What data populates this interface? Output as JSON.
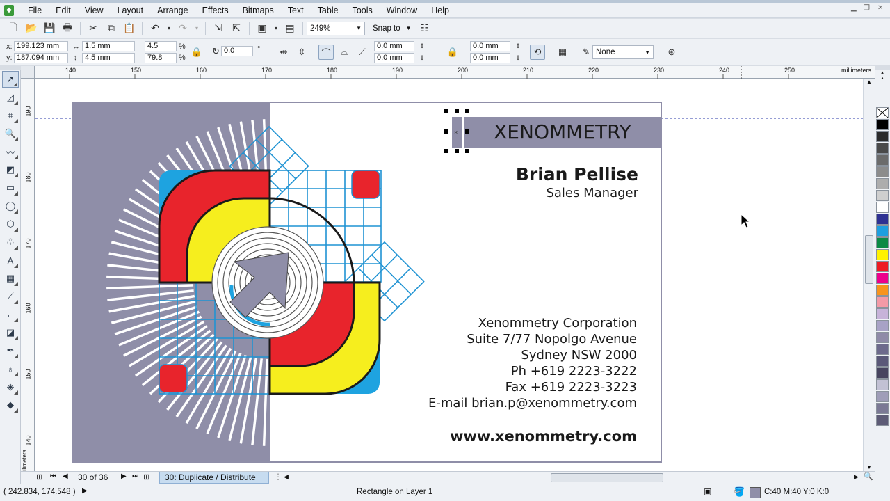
{
  "menu": {
    "app_icon": "corel-app-icon",
    "items": [
      "File",
      "Edit",
      "View",
      "Layout",
      "Arrange",
      "Effects",
      "Bitmaps",
      "Text",
      "Table",
      "Tools",
      "Window",
      "Help"
    ]
  },
  "standard_toolbar": {
    "zoom": "249%",
    "snap": "Snap to"
  },
  "property_bar": {
    "x_label": "x:",
    "x": "199.123 mm",
    "y_label": "y:",
    "y": "187.094 mm",
    "width": "1.5 mm",
    "height": "4.5 mm",
    "scale_x": "4.5",
    "scale_y": "79.8",
    "pct1": "%",
    "pct2": "%",
    "rotation": "0.0",
    "deg": "°",
    "corner1": "0.0 mm",
    "corner2": "0.0 mm",
    "corner3": "0.0 mm",
    "corner4": "0.0 mm",
    "outline": "None"
  },
  "ruler": {
    "h_ticks": [
      "140",
      "150",
      "160",
      "170",
      "180",
      "190",
      "200",
      "210",
      "220",
      "230",
      "240",
      "250"
    ],
    "units": "millimeters",
    "v_ticks": [
      "190",
      "180",
      "170",
      "160",
      "150",
      "140"
    ]
  },
  "card": {
    "company": "XENOMMETRY",
    "name": "Brian  Pellise",
    "title": "Sales Manager",
    "address": [
      "Xenommetry Corporation",
      "Suite 7/77 Nopolgo Avenue",
      "Sydney NSW 2000",
      "Ph +619 2223-3222",
      "Fax +619 2223-3223",
      "E-mail brian.p@xenommetry.com"
    ],
    "website": "www.xenommetry.com"
  },
  "page_nav": {
    "counter": "30 of 36",
    "tab": "30: Duplicate / Distribute"
  },
  "status": {
    "coords": "( 242.834, 174.548 )",
    "selection": "Rectangle on Layer 1",
    "fill": "C:40 M:40 Y:0 K:0"
  },
  "colors": {
    "accent": "#8f8ea8",
    "red": "#e8242c",
    "yellow": "#f6ee1e",
    "cyan": "#1ea3e0",
    "grid_blue": "#1f93d3"
  },
  "palette": [
    "#000000",
    "#2b2b2b",
    "#4a4a4a",
    "#6b6b6b",
    "#8c8c8c",
    "#adadad",
    "#cfcfcf",
    "#ffffff",
    "#2e3192",
    "#1e9fdf",
    "#0b8a44",
    "#fff200",
    "#ed1c24",
    "#ec008c",
    "#f7941d",
    "#f39aa6",
    "#c7b3d9",
    "#a8a2c6",
    "#8f8aa8",
    "#6d6a8c",
    "#5a5878",
    "#47445f",
    "#c2c1d4",
    "#9f9db8",
    "#7b7995",
    "#5d5b76"
  ]
}
